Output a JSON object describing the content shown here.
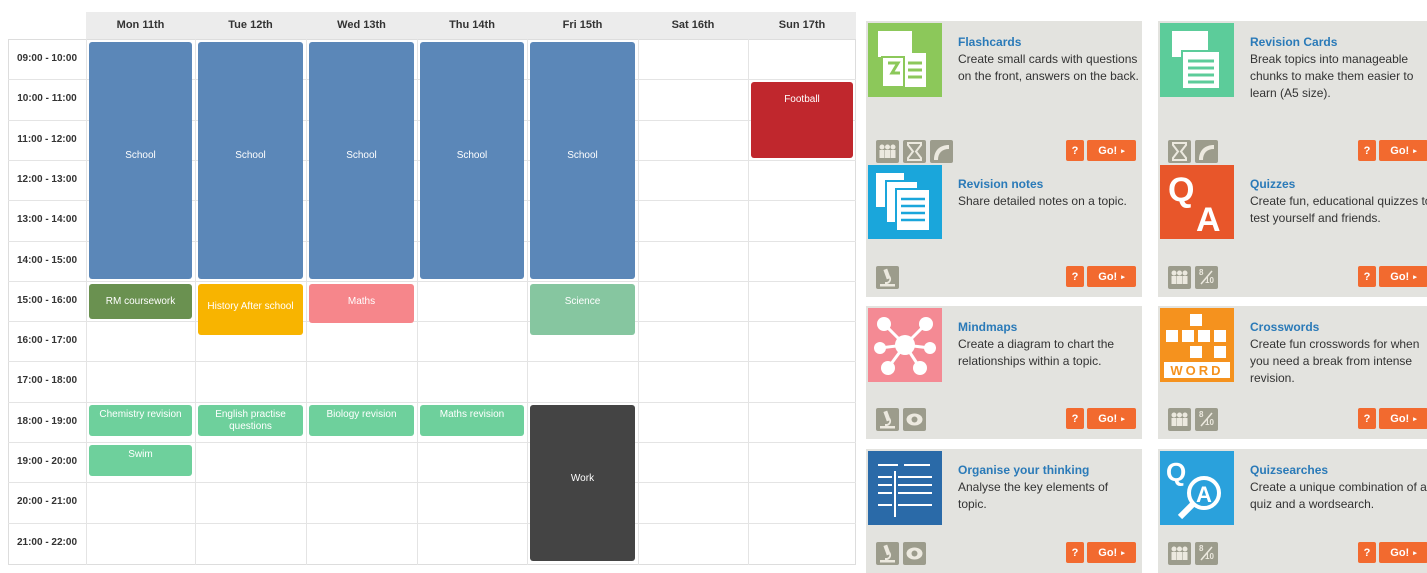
{
  "timetable": {
    "days": [
      "Mon 11th",
      "Tue 12th",
      "Wed 13th",
      "Thu 14th",
      "Fri 15th",
      "Sat 16th",
      "Sun 17th"
    ],
    "times": [
      "09:00 - 10:00",
      "10:00 - 11:00",
      "11:00 - 12:00",
      "12:00 - 13:00",
      "13:00 - 14:00",
      "14:00 - 15:00",
      "15:00 - 16:00",
      "16:00 - 17:00",
      "17:00 - 18:00",
      "18:00 - 19:00",
      "19:00 - 20:00",
      "20:00 - 21:00",
      "21:00 - 22:00"
    ],
    "events": [
      {
        "label": "School",
        "day": 0,
        "start": 9,
        "end": 15,
        "color": "#5b87b8"
      },
      {
        "label": "School",
        "day": 1,
        "start": 9,
        "end": 15,
        "color": "#5b87b8"
      },
      {
        "label": "School",
        "day": 2,
        "start": 9,
        "end": 15,
        "color": "#5b87b8"
      },
      {
        "label": "School",
        "day": 3,
        "start": 9,
        "end": 15,
        "color": "#5b87b8"
      },
      {
        "label": "School",
        "day": 4,
        "start": 9,
        "end": 15,
        "color": "#5b87b8"
      },
      {
        "label": "Football",
        "day": 6,
        "start": 10,
        "end": 12,
        "color": "#c0272d"
      },
      {
        "label": "RM coursework",
        "day": 0,
        "start": 15,
        "end": 16,
        "color": "#6a9150"
      },
      {
        "label": "History After school",
        "day": 1,
        "start": 15,
        "end": 16.4,
        "color": "#f8b400"
      },
      {
        "label": "Maths",
        "day": 2,
        "start": 15,
        "end": 16.1,
        "color": "#f6868b"
      },
      {
        "label": "Science",
        "day": 4,
        "start": 15,
        "end": 16.4,
        "color": "#86c6a0"
      },
      {
        "label": "Chemistry revision",
        "day": 0,
        "start": 18,
        "end": 18.9,
        "color": "#6ed09c"
      },
      {
        "label": "English practise questions",
        "day": 1,
        "start": 18,
        "end": 18.9,
        "color": "#6ed09c"
      },
      {
        "label": "Biology revision",
        "day": 2,
        "start": 18,
        "end": 18.9,
        "color": "#6ed09c"
      },
      {
        "label": "Maths revision",
        "day": 3,
        "start": 18,
        "end": 18.9,
        "color": "#6ed09c"
      },
      {
        "label": "Swim",
        "day": 0,
        "start": 19,
        "end": 19.9,
        "color": "#6ed09c"
      },
      {
        "label": "Work",
        "day": 4,
        "start": 18,
        "end": 22,
        "color": "#444444"
      }
    ]
  },
  "cards": [
    {
      "title": "Flashcards",
      "desc": "Create small cards with questions on the front, answers on the back.",
      "art": "flashcards-art",
      "artColor": "#8cc85a",
      "icons": [
        "group-icon",
        "hourglass-icon",
        "curve-icon"
      ]
    },
    {
      "title": "Revision Cards",
      "desc": "Break topics into manageable chunks to make them easier to learn (A5 size).",
      "art": "revision-cards-art",
      "artColor": "#5ccc9a",
      "icons": [
        "hourglass-icon",
        "curve-icon"
      ]
    },
    {
      "title": "Revision notes",
      "desc": "Share detailed notes on a topic.",
      "art": "revision-notes-art",
      "artColor": "#1aa6db",
      "icons": [
        "microscope-icon"
      ]
    },
    {
      "title": "Quizzes",
      "desc": "Create fun, educational quizzes to test yourself and friends.",
      "art": "quiz-art",
      "artColor": "#e8562a",
      "icons": [
        "group-icon",
        "score-icon"
      ]
    },
    {
      "title": "Mindmaps",
      "desc": "Create a diagram to chart the relationships within a topic.",
      "art": "mindmap-art",
      "artColor": "#f48a94",
      "icons": [
        "microscope-icon",
        "eye-icon"
      ]
    },
    {
      "title": "Crosswords",
      "desc": "Create fun crosswords for when you need a break from intense revision.",
      "art": "crossword-art",
      "artColor": "#f5921e",
      "icons": [
        "group-icon",
        "score-icon"
      ]
    },
    {
      "title": "Organise your thinking",
      "desc": "Analyse the key elements of topic.",
      "art": "organise-art",
      "artColor": "#2a6aa8",
      "icons": [
        "microscope-icon",
        "eye-icon"
      ]
    },
    {
      "title": "Quizsearches",
      "desc": "Create a unique combination of a quiz and a wordsearch.",
      "art": "quizsearch-art",
      "artColor": "#2aa1dc",
      "icons": [
        "group-icon",
        "score-icon"
      ]
    }
  ],
  "buttons": {
    "help": "?",
    "go": "Go!",
    "arrow": "▸"
  },
  "artText": {
    "quizQ": "Q",
    "quizA": "A",
    "word": "WORD",
    "score_num": "8",
    "score_den": "10"
  }
}
